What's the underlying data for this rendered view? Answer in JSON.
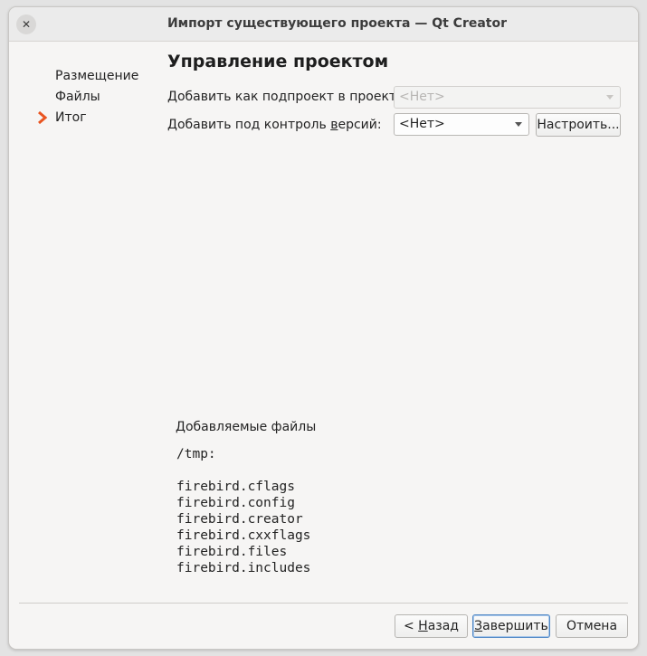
{
  "window": {
    "title": "Импорт существующего проекта — Qt Creator",
    "close_icon": "close-icon"
  },
  "steps": [
    {
      "label": "Размещение",
      "current": false
    },
    {
      "label": "Файлы",
      "current": false
    },
    {
      "label": "Итог",
      "current": true
    }
  ],
  "accent_color": "#e95420",
  "main": {
    "title": "Управление проектом",
    "add_subproject_label": "Добавить как подпроект в проект:",
    "add_subproject_value": "<Нет>",
    "vcs_label_prefix": "Добавить под контроль ",
    "vcs_label_mnemonic": "в",
    "vcs_label_suffix": "ерсий:",
    "vcs_value": "<Нет>",
    "configure_button": "Настроить..."
  },
  "files": {
    "heading": "Добавляемые файлы",
    "directory": "/tmp:",
    "list": [
      "firebird.cflags",
      "firebird.config",
      "firebird.creator",
      "firebird.cxxflags",
      "firebird.files",
      "firebird.includes"
    ]
  },
  "buttons": {
    "back_prefix": "< ",
    "back_mnemonic": "Н",
    "back_suffix": "азад",
    "finish_mnemonic": "З",
    "finish_suffix": "авершить",
    "cancel": "Отмена"
  }
}
